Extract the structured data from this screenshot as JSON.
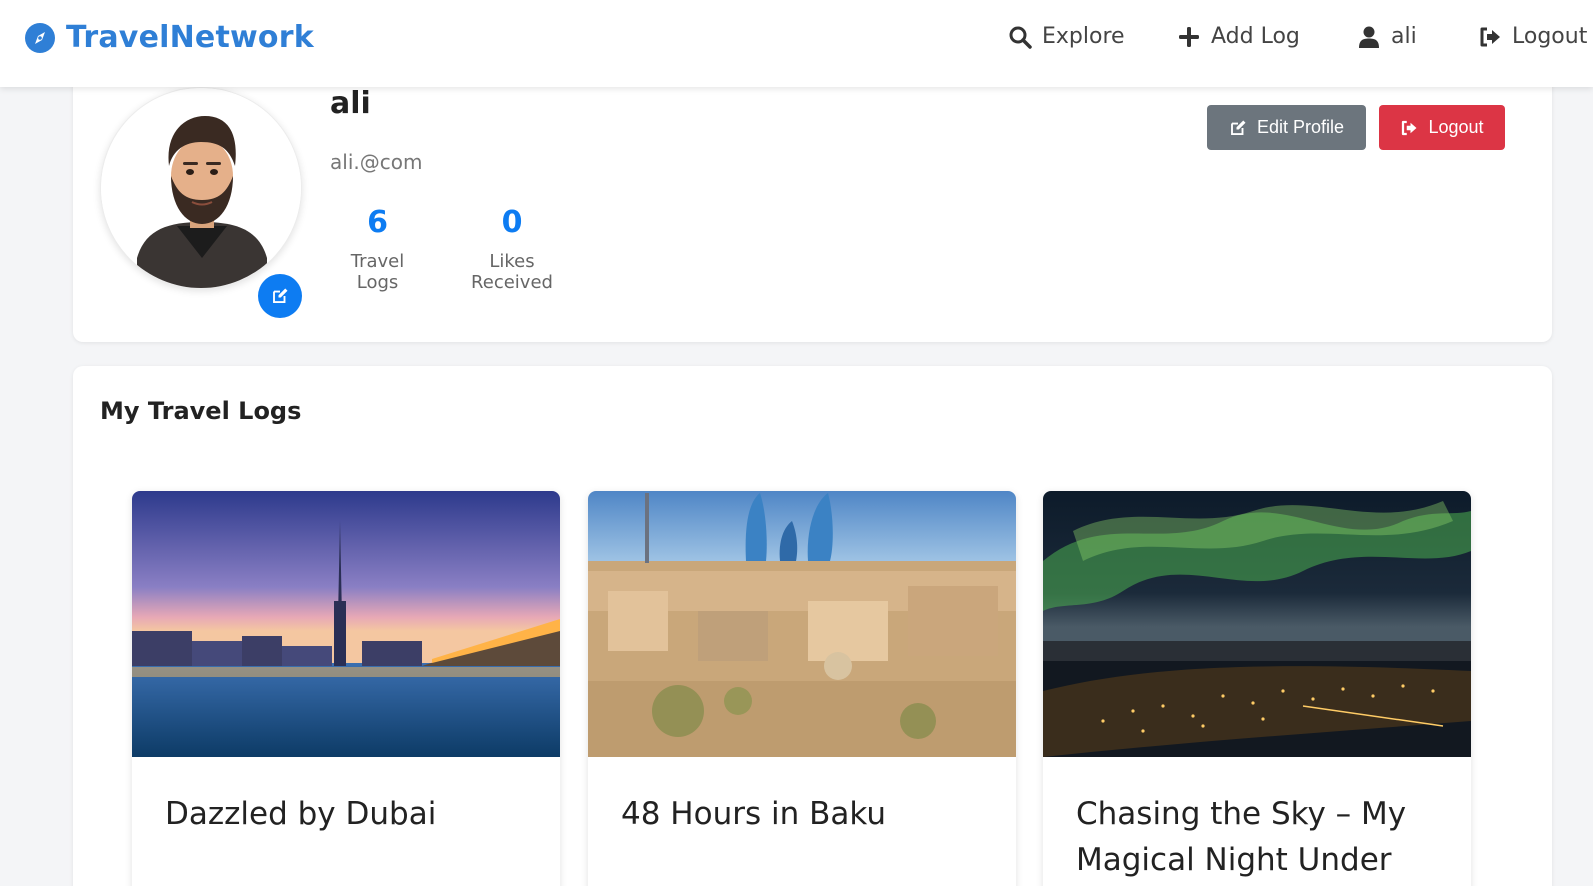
{
  "navbar": {
    "brand": "TravelNetwork",
    "items": [
      {
        "label": "Explore",
        "icon": "search-icon"
      },
      {
        "label": "Add Log",
        "icon": "plus-icon"
      },
      {
        "label": "ali",
        "icon": "user-icon"
      },
      {
        "label": "Logout",
        "icon": "sign-out-icon"
      }
    ]
  },
  "profile": {
    "name": "ali",
    "email": "ali.@com",
    "stats": [
      {
        "value": "6",
        "label": "Travel Logs"
      },
      {
        "value": "0",
        "label": "Likes Received"
      }
    ],
    "edit_button": "Edit Profile",
    "logout_button": "Logout"
  },
  "logs": {
    "title": "My Travel Logs",
    "items": [
      {
        "title": "Dazzled by Dubai",
        "image": "dubai-skyline-image"
      },
      {
        "title": "48 Hours in Baku",
        "image": "baku-city-image"
      },
      {
        "title": "Chasing the Sky – My Magical Night Under the",
        "image": "northern-lights-image"
      }
    ]
  },
  "colors": {
    "brand": "#2f7fd6",
    "accent": "#0d7cf2",
    "secondary_button": "#6c757d",
    "danger_button": "#dc3545"
  }
}
